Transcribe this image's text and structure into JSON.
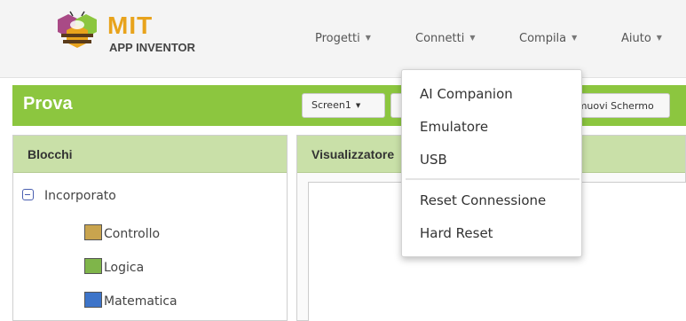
{
  "header": {
    "logo_title": "MIT",
    "logo_subtitle": "APP INVENTOR",
    "nav": [
      {
        "label": "Progetti"
      },
      {
        "label": "Connetti"
      },
      {
        "label": "Compila"
      },
      {
        "label": "Aiuto"
      }
    ]
  },
  "toolbar": {
    "project_name": "Prova",
    "screen_select": "Screen1",
    "remove_screen_label": "Rimuovi Schermo"
  },
  "blocks_panel": {
    "title": "Blocchi",
    "root_label": "Incorporato",
    "items": [
      {
        "label": "Controllo",
        "color": "#c9a44e"
      },
      {
        "label": "Logica",
        "color": "#7fb54a"
      },
      {
        "label": "Matematica",
        "color": "#3d74c9"
      }
    ]
  },
  "viewer_panel": {
    "title": "Visualizzatore"
  },
  "connect_menu": {
    "items": [
      {
        "label": "AI Companion"
      },
      {
        "label": "Emulatore"
      },
      {
        "label": "USB"
      },
      {
        "label": "Reset Connessione"
      },
      {
        "label": "Hard Reset"
      }
    ]
  },
  "colors": {
    "accent_green": "#8cc63f",
    "panel_header": "#c9e0a8",
    "logo_orange": "#e8a31c"
  }
}
